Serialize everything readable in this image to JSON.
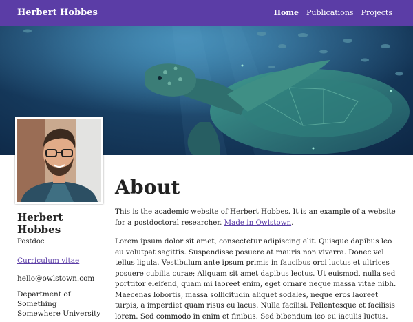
{
  "site": {
    "brand": "Herbert Hobbes"
  },
  "nav": {
    "items": [
      {
        "label": "Home"
      },
      {
        "label": "Publications"
      },
      {
        "label": "Projects"
      }
    ]
  },
  "colors": {
    "accent": "#5b3da6",
    "hero_bg": "#183f63"
  },
  "profile": {
    "name": "Herbert Hobbes",
    "role": "Postdoc",
    "cv_label": "Curriculum vitae",
    "email": "hello@owlstown.com",
    "affiliation_line1": "Department of",
    "affiliation_line2": "Something",
    "affiliation_line3": "Somewhere University"
  },
  "main": {
    "heading": "About",
    "intro_text": "This is the academic website of Herbert Hobbes. It is an example of a website for a postdoctoral researcher. ",
    "intro_link": "Made in Owlstown",
    "intro_end": ".",
    "body": "Lorem ipsum dolor sit amet, consectetur adipiscing elit. Quisque dapibus leo eu volutpat sagittis. Suspendisse posuere at mauris non viverra. Donec vel tellus ligula. Vestibulum ante ipsum primis in faucibus orci luctus et ultrices posuere cubilia curae; Aliquam sit amet dapibus lectus. Ut euismod, nulla sed porttitor eleifend, quam mi laoreet enim, eget ornare neque massa vitae nibh. Maecenas lobortis, massa sollicitudin aliquet sodales, neque eros laoreet turpis, a imperdiet quam risus eu lacus. Nulla facilisi. Pellentesque et facilisis lorem. Sed commodo in enim et finibus. Sed bibendum leo eu iaculis luctus."
  }
}
